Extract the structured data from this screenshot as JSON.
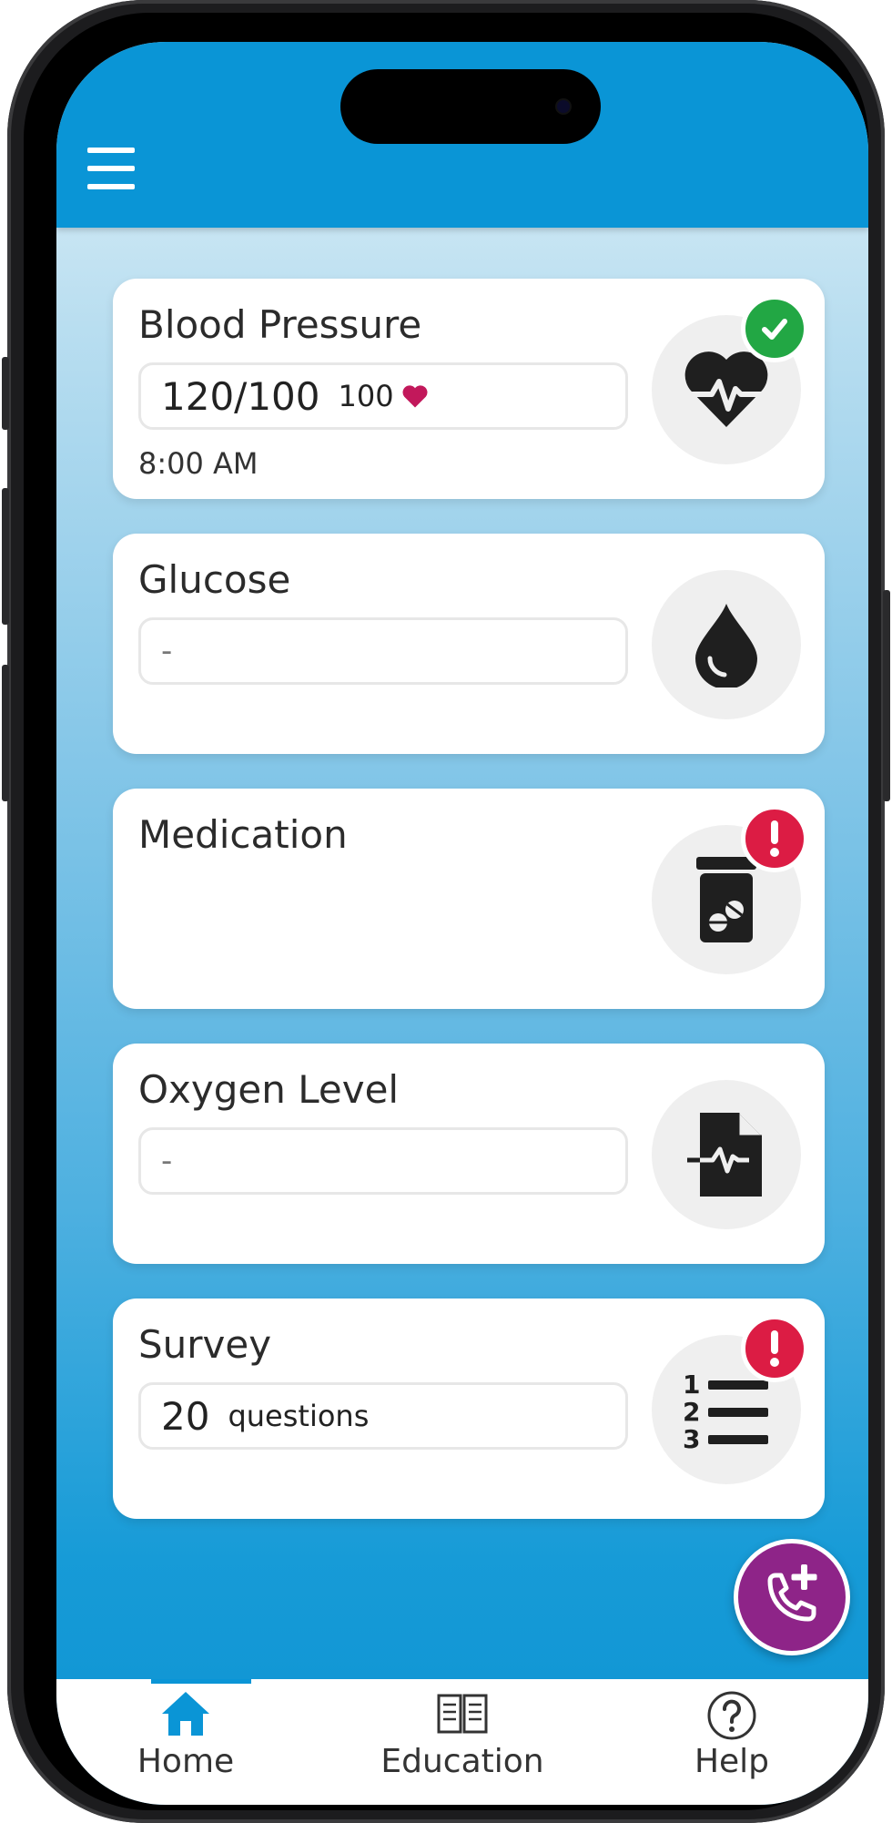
{
  "header": {
    "menu_icon": "hamburger-menu-icon"
  },
  "cards": {
    "blood_pressure": {
      "title": "Blood Pressure",
      "reading": "120/100",
      "pulse": "100",
      "time": "8:00 AM",
      "icon": "heart-pulse-icon",
      "status": "complete",
      "status_icon": "checkmark-icon"
    },
    "glucose": {
      "title": "Glucose",
      "value": "-",
      "icon": "water-drop-icon"
    },
    "medication": {
      "title": "Medication",
      "icon": "pill-bottle-icon",
      "status": "alert",
      "status_icon": "exclamation-icon"
    },
    "oxygen": {
      "title": "Oxygen Level",
      "value": "-",
      "icon": "document-pulse-icon"
    },
    "survey": {
      "title": "Survey",
      "count": "20",
      "count_label": "questions",
      "icon": "numbered-list-icon",
      "status": "alert",
      "status_icon": "exclamation-icon"
    }
  },
  "fab": {
    "icon": "phone-add-icon"
  },
  "tabbar": {
    "items": [
      {
        "label": "Home",
        "icon": "home-icon",
        "active": true
      },
      {
        "label": "Education",
        "icon": "book-icon",
        "active": false
      },
      {
        "label": "Help",
        "icon": "help-circle-icon",
        "active": false
      }
    ]
  },
  "colors": {
    "header": "#0a95d6",
    "ok_badge": "#22a744",
    "alert_badge": "#dc1c44",
    "fab": "#8e2488",
    "heart": "#c2185b"
  }
}
